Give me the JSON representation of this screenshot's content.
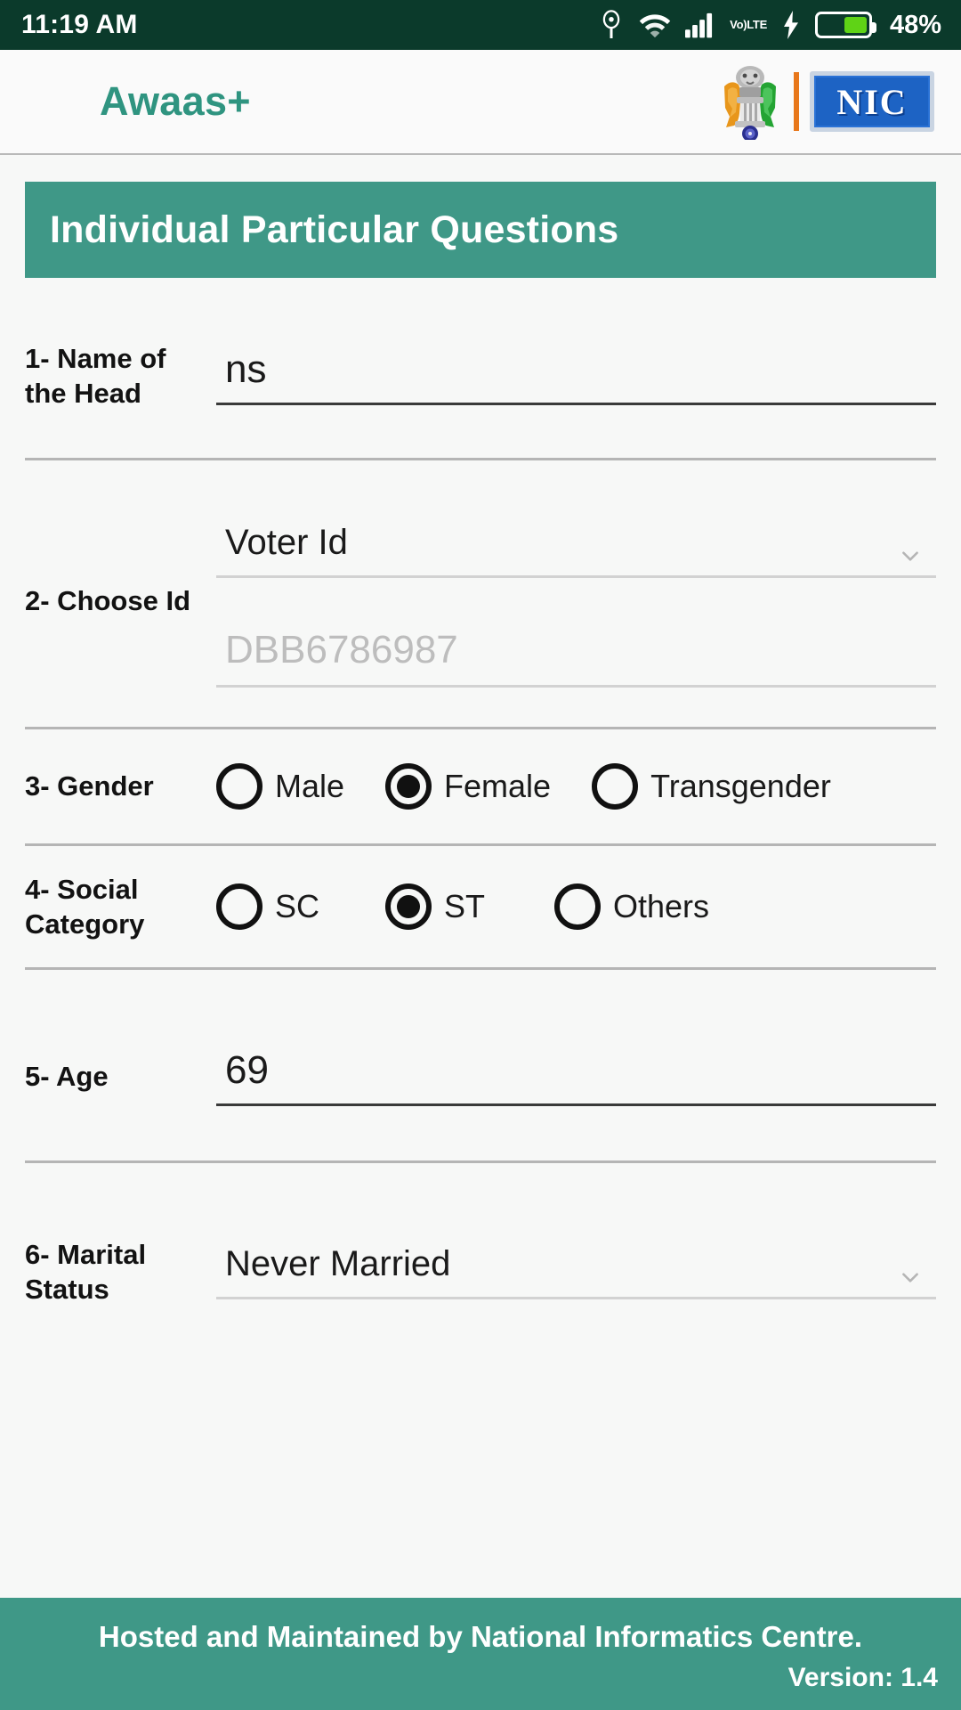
{
  "status_bar": {
    "time": "11:19 AM",
    "battery_percent": "48%",
    "battery_level": 48,
    "volte_top": "Vo)",
    "volte_bottom": "LTE",
    "icons": [
      "hotspot-icon",
      "wifi-icon",
      "signal-icon",
      "volte-icon",
      "charging-bolt-icon",
      "battery-icon"
    ]
  },
  "app_bar": {
    "title": "Awaas+",
    "nic_logo_text": "NIC",
    "emblem_name": "india-national-emblem-icon"
  },
  "section": {
    "title": "Individual Particular Questions"
  },
  "questions": {
    "q1": {
      "label": "1- Name of the Head",
      "value": "ns"
    },
    "q2": {
      "label": "2- Choose Id",
      "selected": "Voter Id",
      "id_placeholder": "DBB6786987",
      "id_value": ""
    },
    "q3": {
      "label": "3- Gender",
      "options": [
        {
          "label": "Male",
          "selected": false
        },
        {
          "label": "Female",
          "selected": true
        },
        {
          "label": "Transgender",
          "selected": false
        }
      ]
    },
    "q4": {
      "label": "4- Social Category",
      "options": [
        {
          "label": "SC",
          "selected": false
        },
        {
          "label": "ST",
          "selected": true
        },
        {
          "label": "Others",
          "selected": false
        }
      ]
    },
    "q5": {
      "label": "5- Age",
      "value": "69"
    },
    "q6": {
      "label": "6- Marital Status",
      "selected": "Never Married"
    }
  },
  "footer": {
    "text": "Hosted and Maintained by National Informatics Centre.",
    "version": "Version: 1.4"
  },
  "colors": {
    "status_bar_bg": "#0b3a2b",
    "brand_teal": "#3f9887",
    "title_teal": "#2f9480",
    "nic_blue": "#1d63c4",
    "divider_orange": "#e8771a",
    "battery_green": "#5fd316"
  }
}
